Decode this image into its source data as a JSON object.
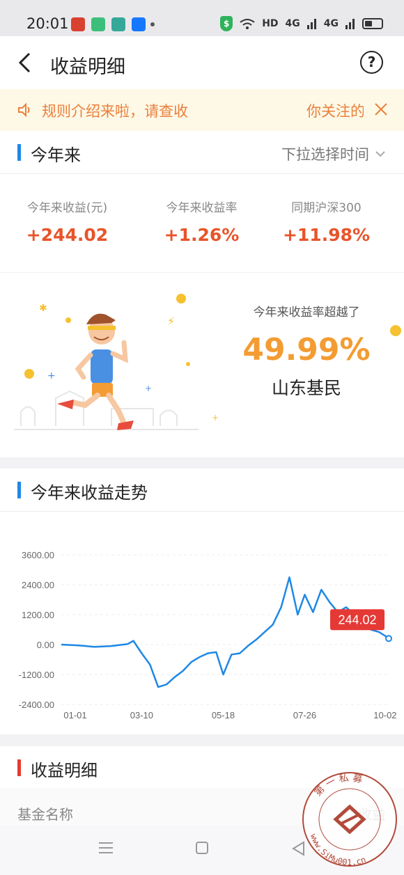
{
  "status_bar": {
    "time": "20:01",
    "network": "HD",
    "signal_1": "4G",
    "signal_2": "4G",
    "shield": "$"
  },
  "nav": {
    "title": "收益明细",
    "help_label": "?"
  },
  "notice": {
    "text": "规则介绍来啦，请查收",
    "text_right": "你关注的"
  },
  "period": {
    "title": "今年来",
    "selector_label": "下拉选择时间"
  },
  "stats": [
    {
      "label": "今年来收益(元)",
      "value": "+244.02"
    },
    {
      "label": "今年来收益率",
      "value": "+1.26%"
    },
    {
      "label": "同期沪深300",
      "value": "+11.98%"
    }
  ],
  "beat": {
    "caption": "今年来收益率超越了",
    "percent": "49.99%",
    "region": "山东基民"
  },
  "trend": {
    "title": "今年来收益走势"
  },
  "details": {
    "title": "收益明细",
    "col_name": "基金名称",
    "col_profit": "收益"
  },
  "watermark": {
    "text": "第一私募 www.SiMu001.cn"
  },
  "colors": {
    "accent_blue": "#1e88e5",
    "profit_orange": "#e8542a",
    "beat_orange": "#f39c33",
    "tooltip_red": "#e53935"
  },
  "chart_data": {
    "type": "line",
    "title": "",
    "xlabel": "",
    "ylabel": "",
    "x_ticks": [
      "01-01",
      "03-10",
      "05-18",
      "07-26",
      "10-02"
    ],
    "y_ticks": [
      "3600.00",
      "2400.00",
      "1200.00",
      "0.00",
      "-1200.00",
      "-2400.00"
    ],
    "ylim": [
      -2400,
      3600
    ],
    "grid": true,
    "end_label": "244.02",
    "series": [
      {
        "x": [
          "01-01",
          "01-15",
          "01-29",
          "02-12",
          "02-26",
          "03-03",
          "03-10",
          "03-17",
          "03-24",
          "03-31",
          "04-07",
          "04-14",
          "04-21",
          "04-28",
          "05-05",
          "05-12",
          "05-18",
          "05-25",
          "06-01",
          "06-08",
          "06-15",
          "06-22",
          "06-29",
          "07-06",
          "07-13",
          "07-20",
          "07-26",
          "08-02",
          "08-09",
          "08-16",
          "08-23",
          "08-30",
          "09-06",
          "09-13",
          "09-20",
          "09-27",
          "10-02",
          "10-05"
        ],
        "y": [
          0,
          -30,
          -90,
          -60,
          20,
          150,
          -350,
          -800,
          -1700,
          -1600,
          -1300,
          -1050,
          -700,
          -500,
          -350,
          -300,
          -1200,
          -400,
          -350,
          -50,
          200,
          500,
          800,
          1500,
          2700,
          1200,
          2000,
          1300,
          2200,
          1700,
          1300,
          1500,
          1200,
          900,
          600,
          500,
          350,
          244
        ]
      }
    ]
  }
}
